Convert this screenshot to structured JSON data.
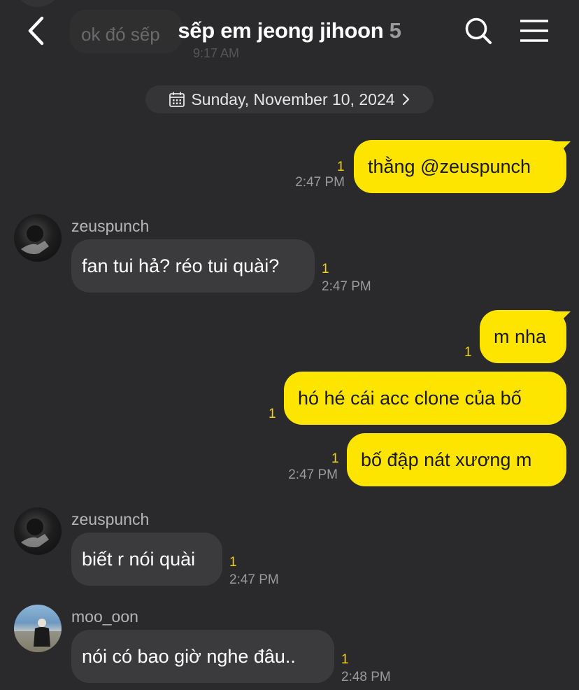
{
  "header": {
    "title": "sếp em jeong jihoon",
    "member_count": "5",
    "ghost_message": "ok đó sếp",
    "ghost_time": "9:17 AM"
  },
  "date_divider": "Sunday, November 10, 2024",
  "messages": [
    {
      "text": "thằng @zeuspunch",
      "unread": "1",
      "time": "2:47 PM"
    },
    {
      "sender": "zeuspunch",
      "text": "fan tui hả? réo tui quài?",
      "unread": "1",
      "time": "2:47 PM"
    },
    {
      "text": "m nha",
      "unread": "1"
    },
    {
      "text": "hó hé cái acc clone của bố",
      "unread": "1"
    },
    {
      "text": "bố đập nát xương m",
      "unread": "1",
      "time": "2:47 PM"
    },
    {
      "sender": "zeuspunch",
      "text": "biết r nói quài",
      "unread": "1",
      "time": "2:47 PM"
    },
    {
      "sender": "moo_oon",
      "text": "nói có bao giờ nghe đâu..",
      "unread": "1",
      "time": "2:48 PM"
    }
  ],
  "colors": {
    "background": "#2a2a2c",
    "my_bubble": "#fee500",
    "their_bubble": "#3b3b3d",
    "unread": "#f5d400"
  },
  "icons": {
    "back": "chevron-left-icon",
    "search": "search-icon",
    "menu": "hamburger-menu-icon",
    "calendar": "calendar-icon",
    "date_chevron": "chevron-right-icon"
  }
}
